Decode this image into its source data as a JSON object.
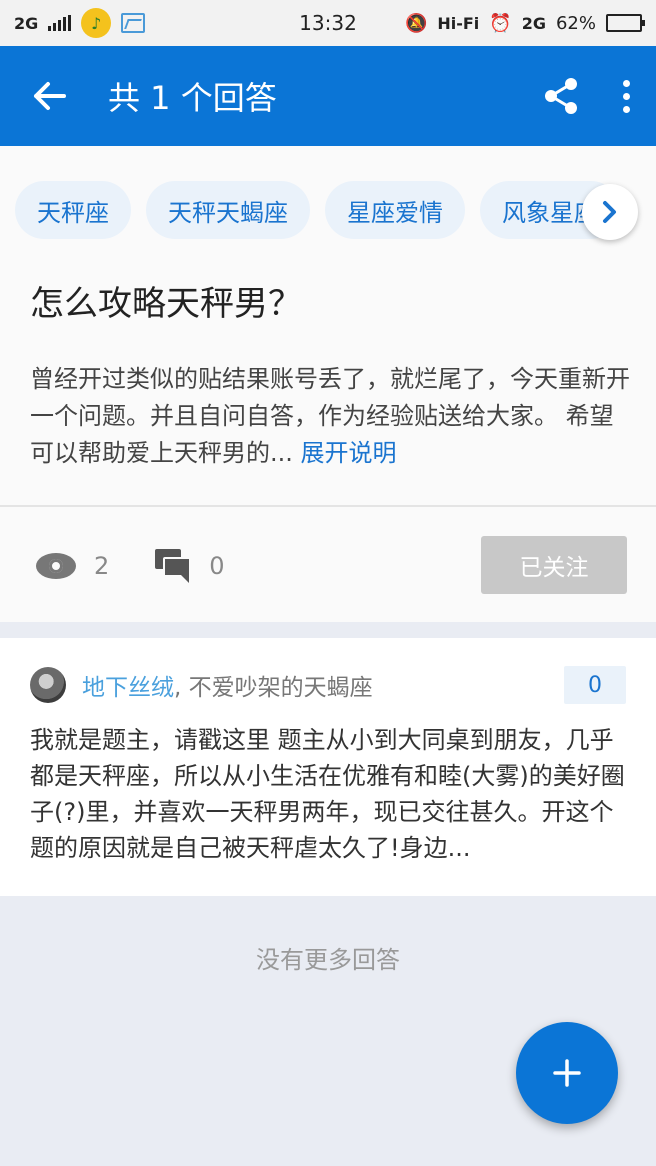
{
  "status_bar": {
    "network": "2G",
    "time": "13:32",
    "hifi": "Hi-Fi",
    "network2": "2G",
    "battery": "62%"
  },
  "app_bar": {
    "title": "共 1 个回答"
  },
  "question": {
    "tags": [
      "天秤座",
      "天秤天蝎座",
      "星座爱情",
      "风象星座"
    ],
    "title": "怎么攻略天秤男？",
    "description": "曾经开过类似的贴结果账号丢了，就烂尾了，今天重新开一个问题。并且自问自答，作为经验贴送给大家。 希望可以帮助爱上天秤男的... ",
    "expand_label": "展开说明",
    "views": "2",
    "comments": "0",
    "follow_label": "已关注"
  },
  "answer": {
    "author": "地下丝绒",
    "bio": ", 不爱吵架的天蝎座",
    "votes": "0",
    "text": "我就是题主，请戳这里 题主从小到大同桌到朋友，几乎都是天秤座，所以从小生活在优雅有和睦(大雾)的美好圈子(?)里，并喜欢一天秤男两年，现已交往甚久。开这个题的原因就是自己被天秤虐太久了!身边..."
  },
  "footer": {
    "no_more": "没有更多回答"
  },
  "icons": {
    "back": "arrow-left-icon",
    "share": "share-icon",
    "more": "more-vert-icon",
    "views": "eye-icon",
    "comments": "comment-icon",
    "next": "chevron-right-icon",
    "add": "plus-icon"
  },
  "colors": {
    "primary": "#0b75d6",
    "link": "#1a74cf",
    "tag_bg": "#eaf2fa",
    "follow_bg": "#c8c8c8"
  }
}
